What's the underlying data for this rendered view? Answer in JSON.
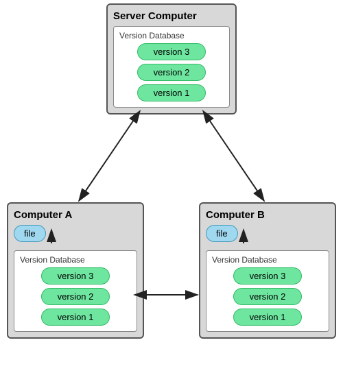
{
  "server": {
    "title": "Server Computer",
    "db_label": "Version Database",
    "versions": [
      "version 3",
      "version 2",
      "version 1"
    ]
  },
  "computer_a": {
    "title": "Computer A",
    "file_label": "file",
    "db_label": "Version Database",
    "versions": [
      "version 3",
      "version 2",
      "version 1"
    ]
  },
  "computer_b": {
    "title": "Computer B",
    "file_label": "file",
    "db_label": "Version Database",
    "versions": [
      "version 3",
      "version 2",
      "version 1"
    ]
  }
}
